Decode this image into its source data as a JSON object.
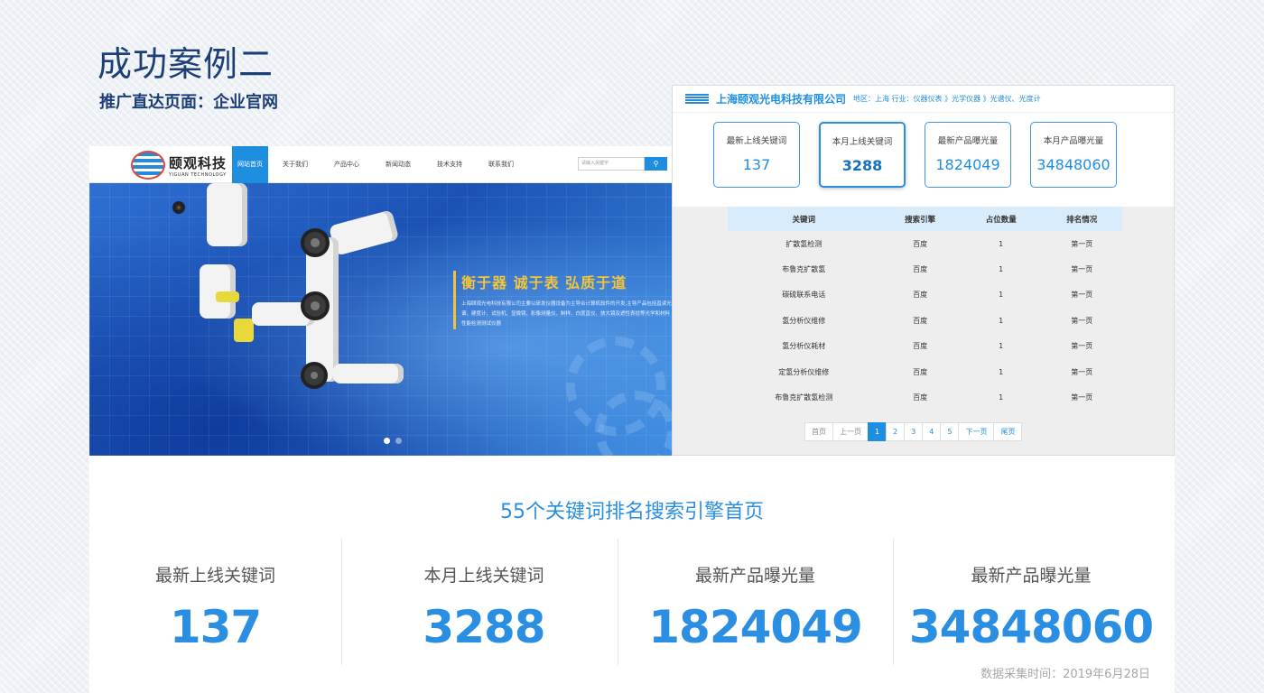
{
  "page": {
    "title": "成功案例二",
    "subtitle": "推广直达页面：企业官网"
  },
  "website": {
    "logo_cn": "颐观科技",
    "logo_en": "YIGUAN TECHNOLOGY",
    "menu": [
      "网站首页",
      "关于我们",
      "产品中心",
      "新闻动态",
      "技术支持",
      "联系我们"
    ],
    "search_placeholder": "请输入关键字",
    "slogan": "衡于器  诚于表  弘质于道",
    "slogan_desc": "上海颐观光电科技有限公司主要以研发仪器设备为主导合计算机软件的开发,主导产品包括直读光谱、硬度计、试验机、显微镜、影像测量仪、制样、白度直仪、放大镜及遮性表捻等光学和材料性能检测测试仪器",
    "active_slide": 0,
    "slide_count": 2
  },
  "panel": {
    "company": "上海颐观光电科技有限公司",
    "meta": "地区：上海   行业：仪器仪表 》光学仪器 》光谱仪、光度计",
    "cards": [
      {
        "label": "最新上线关键词",
        "value": "137"
      },
      {
        "label": "本月上线关键词",
        "value": "3288"
      },
      {
        "label": "最新产品曝光量",
        "value": "1824049"
      },
      {
        "label": "本月产品曝光量",
        "value": "34848060"
      }
    ],
    "table_headers": [
      "关键词",
      "搜索引擎",
      "占位数量",
      "排名情况"
    ],
    "rows": [
      [
        "扩散氢检测",
        "百度",
        "1",
        "第一页"
      ],
      [
        "布鲁克扩散氢",
        "百度",
        "1",
        "第一页"
      ],
      [
        "碳硫联系电话",
        "百度",
        "1",
        "第一页"
      ],
      [
        "氢分析仪维修",
        "百度",
        "1",
        "第一页"
      ],
      [
        "氢分析仪耗材",
        "百度",
        "1",
        "第一页"
      ],
      [
        "定氢分析仪维修",
        "百度",
        "1",
        "第一页"
      ],
      [
        "布鲁克扩散氢检测",
        "百度",
        "1",
        "第一页"
      ]
    ],
    "pager": {
      "first": "首页",
      "prev": "上一页",
      "pages": [
        "1",
        "2",
        "3",
        "4",
        "5"
      ],
      "next": "下一页",
      "last": "尾页",
      "current": "1"
    }
  },
  "summary": {
    "title": "55个关键词排名搜索引擎首页",
    "stats": [
      {
        "label": "最新上线关键词",
        "value": "137"
      },
      {
        "label": "本月上线关键词",
        "value": "3288"
      },
      {
        "label": "最新产品曝光量",
        "value": "1824049"
      },
      {
        "label": "最新产品曝光量",
        "value": "34848060"
      }
    ],
    "collected": "数据采集时间：2019年6月28日"
  },
  "colors": {
    "title": "#1d3f78",
    "accent": "#2a8fe2",
    "banner": "#1b52b4",
    "slogan": "#f4c53a"
  }
}
